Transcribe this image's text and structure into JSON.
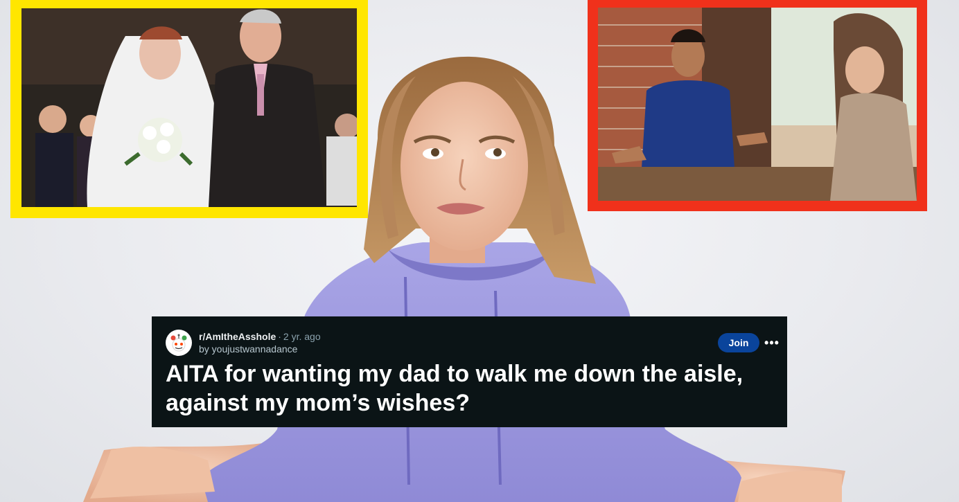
{
  "reddit_post": {
    "subreddit": "r/AmItheAsshole",
    "separator": "·",
    "age": "2 yr. ago",
    "author_line": "by youjustwannadance",
    "join_label": "Join",
    "more_label": "•••",
    "title": "AITA for wanting my dad to walk me down the aisle, against my mom’s wishes?"
  },
  "photos": {
    "left_frame_color": "#ffe600",
    "right_frame_color": "#f0311b"
  },
  "icons": {
    "avatar": "subreddit-avatar-icon",
    "more": "more-options-icon"
  },
  "colors": {
    "card_bg": "#0b1416",
    "join_bg": "#0a449b",
    "hoodie": "#9f9be0"
  }
}
